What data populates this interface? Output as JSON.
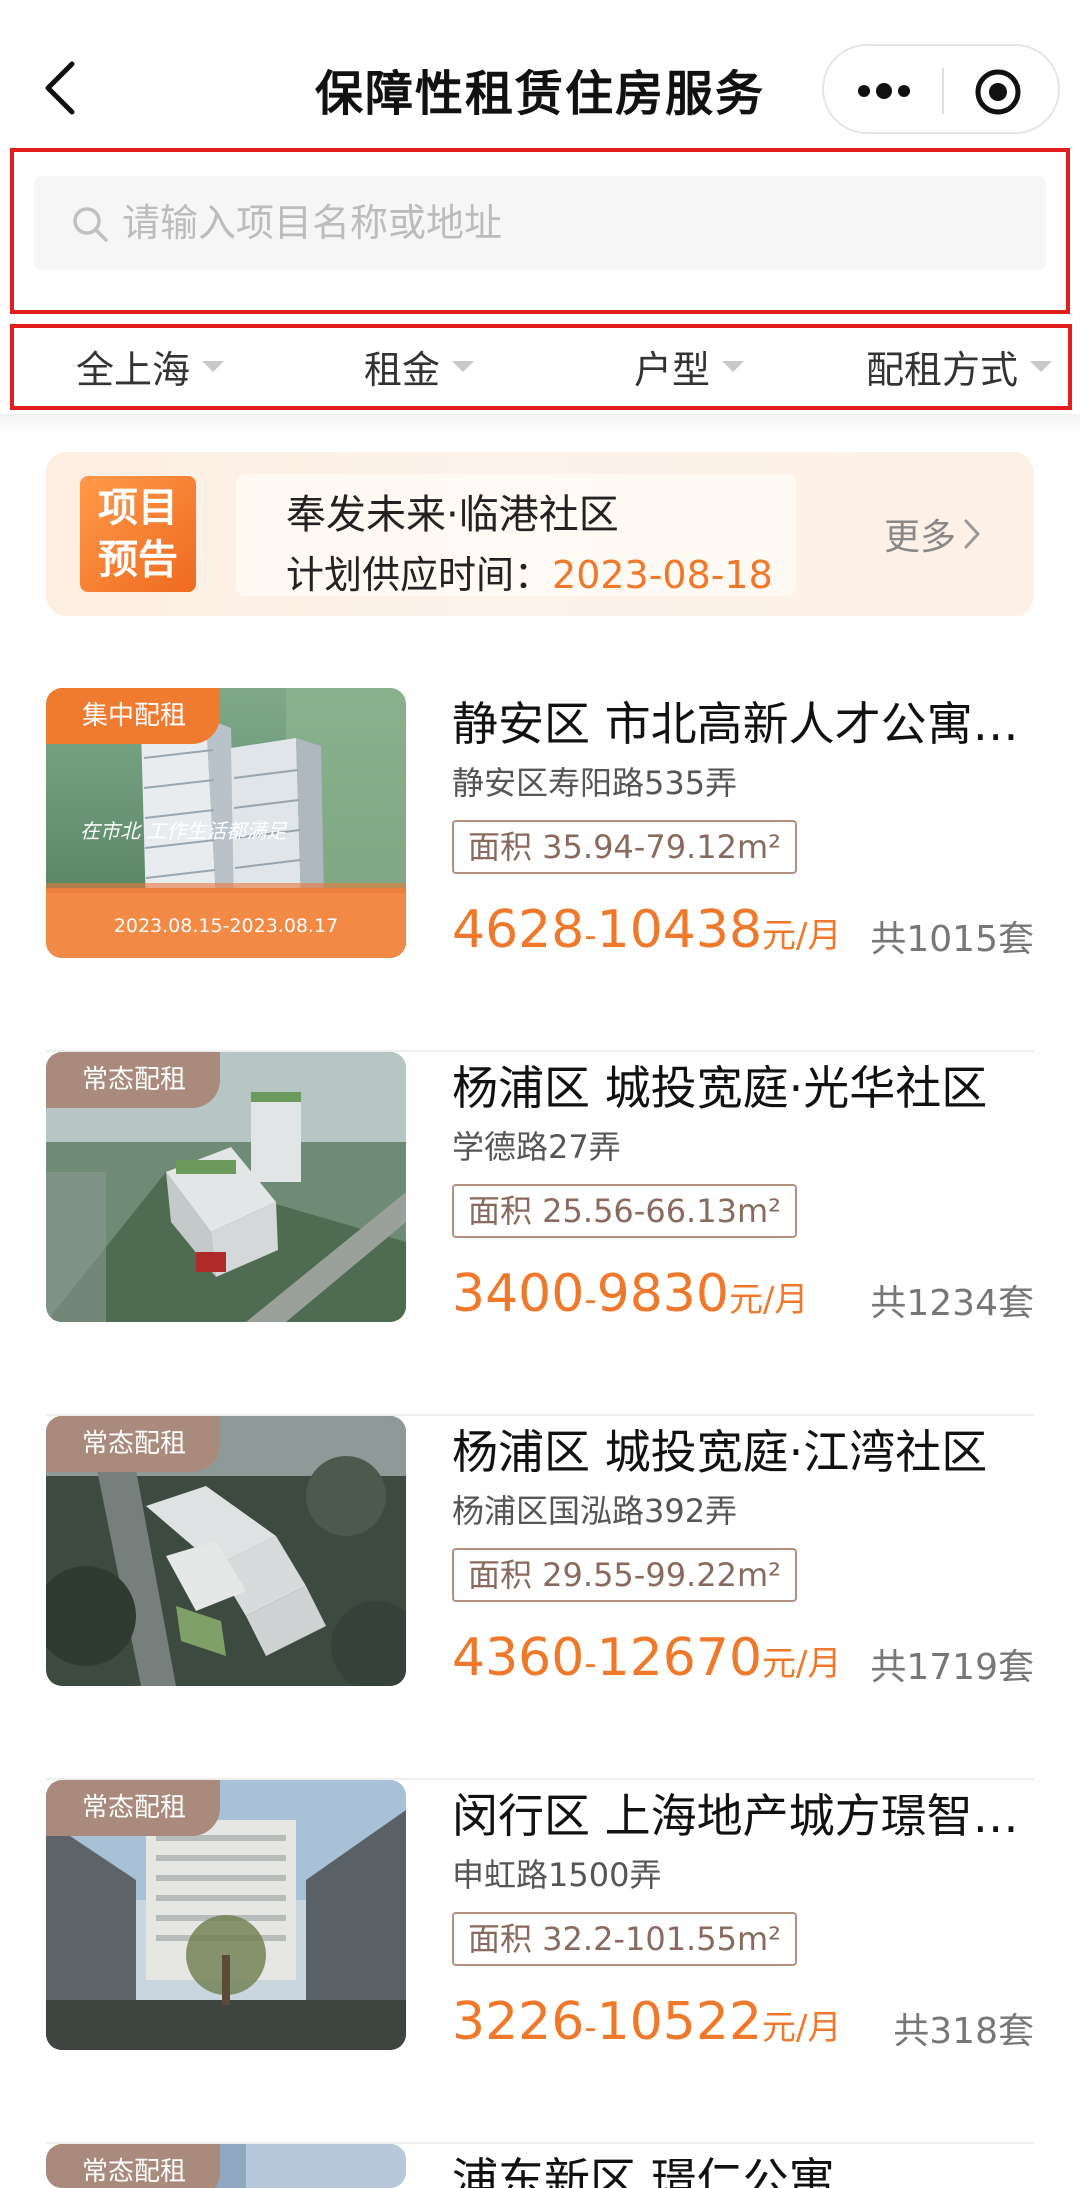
{
  "header": {
    "title": "保障性租赁住房服务"
  },
  "search": {
    "placeholder": "请输入项目名称或地址"
  },
  "filters": [
    {
      "label": "全上海"
    },
    {
      "label": "租金"
    },
    {
      "label": "户型"
    },
    {
      "label": "配租方式"
    }
  ],
  "banner": {
    "badge_line1": "项目",
    "badge_line2": "预告",
    "project_name": "奉发未来·临港社区",
    "time_label": "计划供应时间：",
    "time_value": "2023-08-18",
    "more_label": "更多"
  },
  "listings": [
    {
      "tag": "集中配租",
      "tag_color": "#f07a30",
      "image_caption": "2023.08.15-2023.08.17",
      "image_text": "在市北 工作生活都满足",
      "title": "静安区 市北高新人才公寓…",
      "address": "静安区寿阳路535弄",
      "area": "面积 35.94-79.12m²",
      "price_low": "4628",
      "price_high": "10438",
      "price_unit": "元/月",
      "count": "共1015套"
    },
    {
      "tag": "常态配租",
      "tag_color": "#a98a7c",
      "title": "杨浦区 城投宽庭·光华社区",
      "address": "学德路27弄",
      "area": "面积 25.56-66.13m²",
      "price_low": "3400",
      "price_high": "9830",
      "price_unit": "元/月",
      "count": "共1234套"
    },
    {
      "tag": "常态配租",
      "tag_color": "#a98a7c",
      "title": "杨浦区 城投宽庭·江湾社区",
      "address": "杨浦区国泓路392弄",
      "area": "面积 29.55-99.22m²",
      "price_low": "4360",
      "price_high": "12670",
      "price_unit": "元/月",
      "count": "共1719套"
    },
    {
      "tag": "常态配租",
      "tag_color": "#a98a7c",
      "title": "闵行区 上海地产城方璟智…",
      "address": "申虹路1500弄",
      "area": "面积 32.2-101.55m²",
      "price_low": "3226",
      "price_high": "10522",
      "price_unit": "元/月",
      "count": "共318套"
    },
    {
      "tag": "常态配租",
      "tag_color": "#a98a7c",
      "title": "浦东新区 璟仁公寓"
    }
  ],
  "colors": {
    "accent_orange": "#f07a30",
    "highlight_red_border": "#e11d1d",
    "area_border": "#b58f7f"
  }
}
